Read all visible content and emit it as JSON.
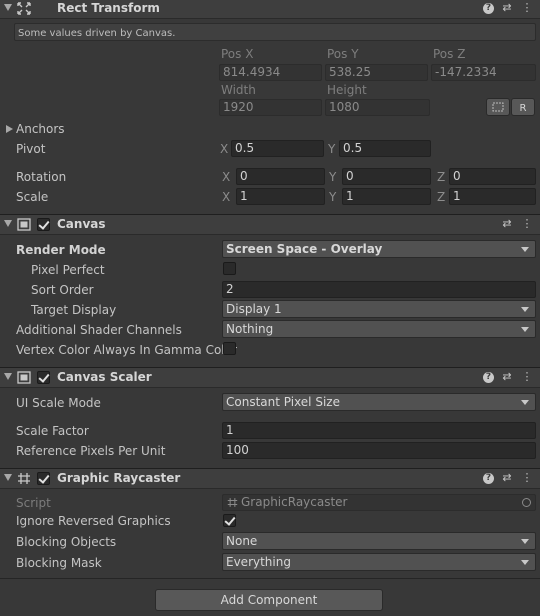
{
  "rect_transform": {
    "title": "Rect Transform",
    "driven_note": "Some values driven by Canvas.",
    "pos_x_label": "Pos X",
    "pos_y_label": "Pos Y",
    "pos_z_label": "Pos Z",
    "pos_x": "814.4934",
    "pos_y": "538.25",
    "pos_z": "-147.2334",
    "width_label": "Width",
    "height_label": "Height",
    "width": "1920",
    "height": "1080",
    "r_button": "R",
    "anchors_label": "Anchors",
    "pivot_label": "Pivot",
    "pivot_x": "0.5",
    "pivot_y": "0.5",
    "rotation_label": "Rotation",
    "rot_x": "0",
    "rot_y": "0",
    "rot_z": "0",
    "scale_label": "Scale",
    "scale_x": "1",
    "scale_y": "1",
    "scale_z": "1",
    "axis_x": "X",
    "axis_y": "Y",
    "axis_z": "Z"
  },
  "canvas": {
    "title": "Canvas",
    "render_mode_label": "Render Mode",
    "render_mode": "Screen Space - Overlay",
    "pixel_perfect_label": "Pixel Perfect",
    "sort_order_label": "Sort Order",
    "sort_order": "2",
    "target_display_label": "Target Display",
    "target_display": "Display 1",
    "shader_channels_label": "Additional Shader Channels",
    "shader_channels": "Nothing",
    "vertex_color_label": "Vertex Color Always In Gamma Color"
  },
  "canvas_scaler": {
    "title": "Canvas Scaler",
    "ui_scale_mode_label": "UI Scale Mode",
    "ui_scale_mode": "Constant Pixel Size",
    "scale_factor_label": "Scale Factor",
    "scale_factor": "1",
    "ref_ppu_label": "Reference Pixels Per Unit",
    "ref_ppu": "100"
  },
  "graphic_raycaster": {
    "title": "Graphic Raycaster",
    "script_label": "Script",
    "script": "GraphicRaycaster",
    "ignore_reversed_label": "Ignore Reversed Graphics",
    "blocking_objects_label": "Blocking Objects",
    "blocking_objects": "None",
    "blocking_mask_label": "Blocking Mask",
    "blocking_mask": "Everything"
  },
  "add_component": "Add Component",
  "icons": {
    "help": "?",
    "settings": "⇄",
    "menu": "⋮"
  }
}
